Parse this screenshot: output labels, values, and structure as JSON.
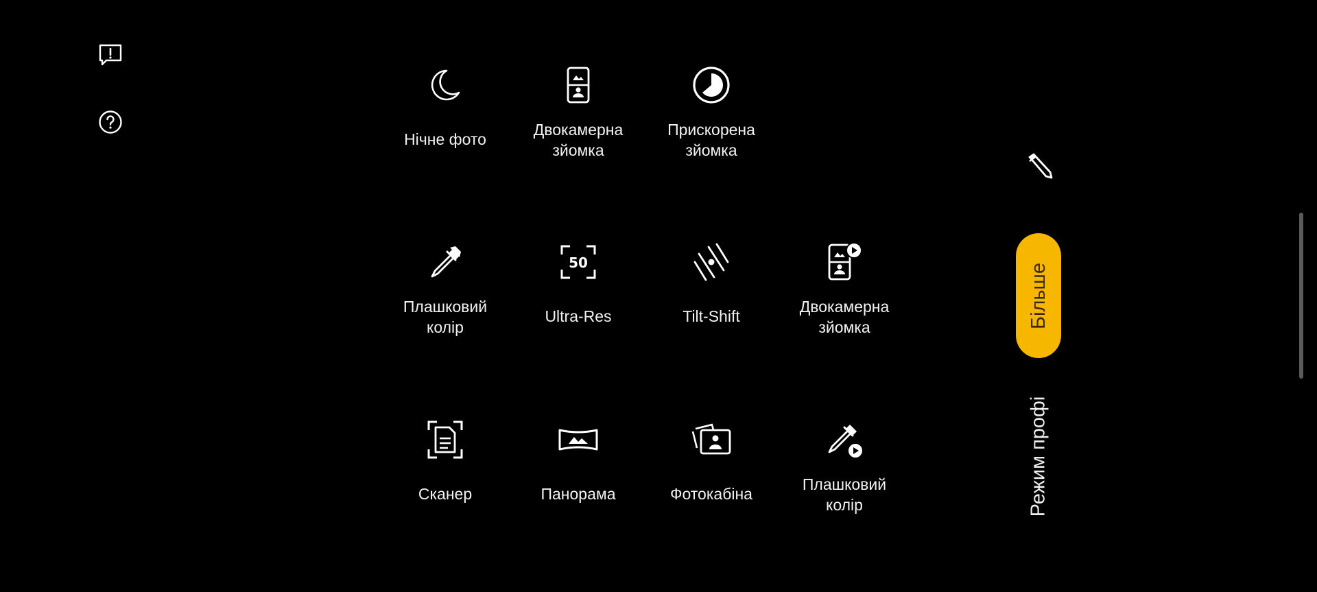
{
  "side": {
    "feedback_icon": "feedback-icon",
    "help_icon": "help-icon"
  },
  "modes": [
    {
      "label": "Нічне фото",
      "icon": "moon-icon"
    },
    {
      "label": "Двокамерна\nзйомка",
      "icon": "dual-camera-icon"
    },
    {
      "label": "Прискорена\nзйомка",
      "icon": "timelapse-icon"
    },
    {
      "label": "Плашковий\nколір",
      "icon": "color-picker-icon"
    },
    {
      "label": "Ultra-Res",
      "icon": "ultra-res-icon"
    },
    {
      "label": "Tilt-Shift",
      "icon": "tilt-shift-icon"
    },
    {
      "label": "Двокамерна\nзйомка",
      "icon": "dual-camera-video-icon"
    },
    {
      "label": "Сканер",
      "icon": "scanner-icon"
    },
    {
      "label": "Панорама",
      "icon": "panorama-icon"
    },
    {
      "label": "Фотокабіна",
      "icon": "photobooth-icon"
    },
    {
      "label": "Плашковий\nколір",
      "icon": "color-picker-video-icon"
    }
  ],
  "ultra_res_badge": "50",
  "right": {
    "edit_icon": "pencil-icon",
    "active_mode": "Більше",
    "next_mode": "Режим профі",
    "accent_color": "#f7b600"
  }
}
